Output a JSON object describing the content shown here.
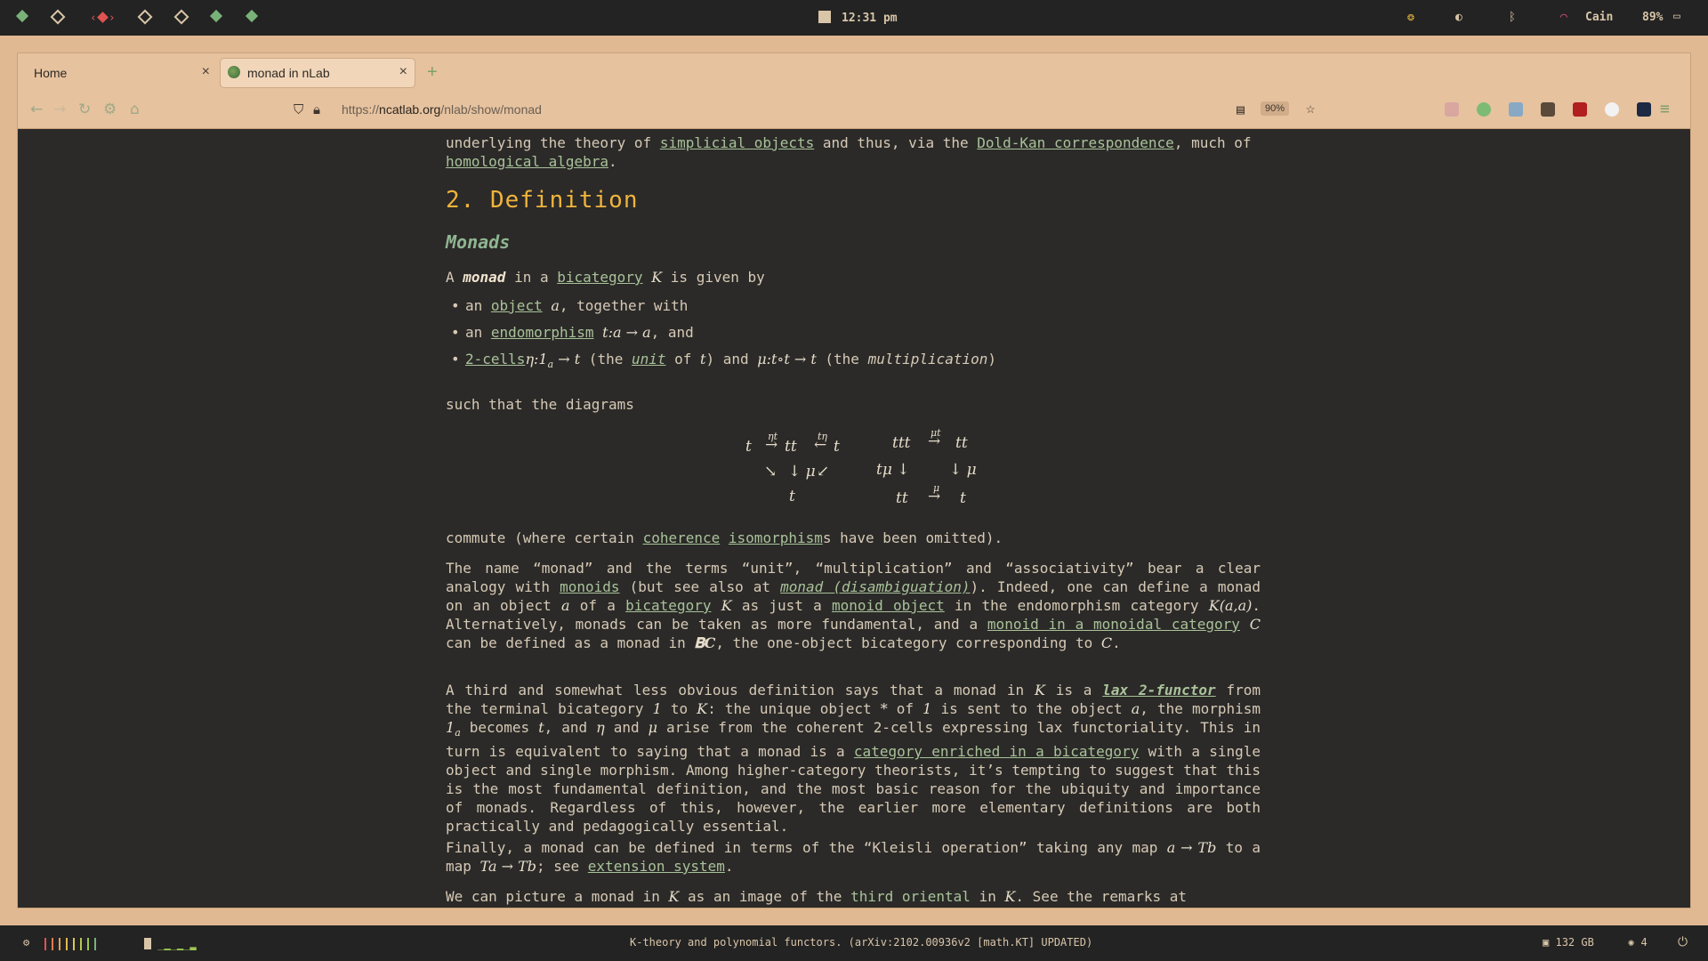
{
  "topbar": {
    "time": "12:31 pm",
    "wifi_name": "Cain",
    "battery": "89%"
  },
  "browser": {
    "tabs": [
      {
        "title": "Home",
        "close": "×"
      },
      {
        "title": "monad in nLab",
        "close": "×"
      }
    ],
    "new_tab": "+",
    "url_prefix": "https://",
    "url_host": "ncatlab.org",
    "url_path": "/nlab/show/monad",
    "zoom": "90%"
  },
  "article": {
    "intro_line1_pre": "underlying the theory of ",
    "intro_link1": "simplicial objects",
    "intro_line1_mid": " and thus, via the ",
    "intro_link2": "Dold-Kan correspondence",
    "intro_line1_post": ", much of",
    "intro_link3": "homological algebra",
    "intro_end": ".",
    "section_heading": "2. Definition",
    "subheading": "Monads",
    "lead_a": "A ",
    "lead_bold": "monad",
    "lead_b": " in a ",
    "lead_link": "bicategory",
    "lead_k": "K",
    "lead_c": " is given by",
    "bullets": {
      "b1_a": "an ",
      "b1_link": "object",
      "b1_m": "a",
      "b1_b": ", together with",
      "b2_a": "an ",
      "b2_link": "endomorphism",
      "b2_m": "t:a → a",
      "b2_b": ", and",
      "b3_link": "2-cells",
      "b3_m1": "η:1",
      "b3_sub": "a",
      "b3_m2": " → t",
      "b3_a": " (the ",
      "b3_unit": "unit",
      "b3_b": " of ",
      "b3_t": "t",
      "b3_c": ") and ",
      "b3_m3": "μ:t∘t → t",
      "b3_d": " (the ",
      "b3_mult": "multiplication",
      "b3_e": ")"
    },
    "such_that": "such that the diagrams",
    "diagram1": {
      "t_left": "t",
      "arrow1": "→",
      "label1": "ηt",
      "tt": "tt",
      "arrow2": "←",
      "label2": "tη",
      "t_right": "t",
      "diag_left": "↘",
      "down_mid": "↓ μ",
      "diag_right": "↙",
      "t_bottom": "t"
    },
    "diagram2": {
      "ttt": "ttt",
      "arrow_top": "→",
      "label_top": "μt",
      "tt_top": "tt",
      "left_label": "tμ ↓",
      "right_label": "↓ μ",
      "tt_bottom": "tt",
      "arrow_bottom": "→",
      "label_bottom": "μ",
      "t_bottom": "t"
    },
    "commute_a": "commute (where certain ",
    "commute_link1": "coherence",
    "commute_link2": "isomorphism",
    "commute_b": "s have been omitted).",
    "p1": {
      "a": "The name “monad” and the terms “unit”, “multiplication” and “associativity” bear a clear analogy with ",
      "link1": "monoids",
      "b": " (but see also at ",
      "link2": "monad (disambiguation)",
      "c": "). Indeed, one can define a monad on an object ",
      "m1": "a",
      "d": " of a ",
      "link3": "bicategory",
      "m2": "K",
      "e": " as just a ",
      "link4": "monoid object",
      "f": " in the endomorphism category ",
      "m3": "K(a,a)",
      "g": ". Alternatively, monads can be taken as more fundamental, and a ",
      "link5": "monoid in a monoidal category",
      "m4": "C",
      "h": " can be defined as a monad in ",
      "m5": "𝐁C",
      "i": ", the one-object bicategory corresponding to ",
      "m6": "C",
      "j": "."
    },
    "p2": {
      "a": "A third and somewhat less obvious definition says that a monad in ",
      "m1": "K",
      "b": " is a ",
      "link1": "lax 2-functor",
      "c": " from the terminal bicategory ",
      "m2": "1",
      "d": " to ",
      "m3": "K",
      "e": ": the unique object ",
      "m4": "*",
      "f": " of ",
      "m5": "1",
      "g": " is sent to the object ",
      "m6": "a",
      "h": ", the morphism ",
      "m7": "1",
      "sub": "a",
      "i": " becomes ",
      "m8": "t",
      "j": ", and ",
      "m9": "η",
      "k": " and ",
      "m10": "μ",
      "l": " arise from the coherent 2-cells expressing lax functoriality. This in turn is equivalent to saying that a monad is a ",
      "link2": "category enriched in a bicategory",
      "m": " with a single object and single morphism. Among higher-category theorists, it’s tempting to suggest that this is the most fundamental definition, and the most basic reason for the ubiquity and importance of monads. Regardless of this, however, the earlier more elementary definitions are both practically and pedagogically essential."
    },
    "p3": {
      "a": "Finally, a monad can be defined in terms of the “Kleisli operation” taking any map ",
      "m1": "a → Tb",
      "b": " to a map ",
      "m2": "Ta → Tb",
      "c": "; see ",
      "link1": "extension system",
      "d": "."
    },
    "p4": {
      "a": "We can picture a monad in ",
      "m1": "K",
      "b": " as an image of the ",
      "link1": "third oriental",
      "c": " in ",
      "m2": "K",
      "d": ". See the remarks at"
    }
  },
  "bottombar": {
    "notification": "K-theory and polynomial functors. (arXiv:2102.00936v2 [math.KT] UPDATED)",
    "disk": "132 GB",
    "workspace": "4"
  },
  "colors": {
    "accent_heading": "#f0b43c",
    "subheading": "#8fb591",
    "link": "#a9c29a",
    "page_bg": "#2b2a28",
    "chrome_bg": "#e6c29f"
  }
}
